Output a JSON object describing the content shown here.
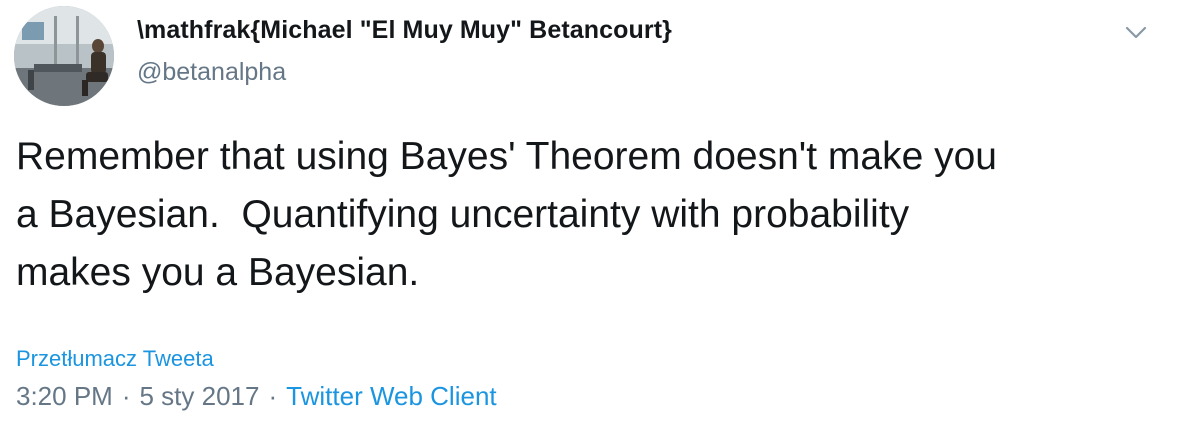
{
  "user": {
    "display_name": "\\mathfrak{Michael \"El Muy Muy\" Betancourt}",
    "handle": "@betanalpha"
  },
  "tweet": {
    "text": "Remember that using Bayes' Theorem doesn't make you\na Bayesian.  Quantifying uncertainty with probability\nmakes you a Bayesian.",
    "translate_label": "Przetłumacz Tweeta",
    "time": "3:20 PM",
    "separator": "·",
    "date": "5 sty 2017",
    "source": "Twitter Web Client"
  },
  "icons": {
    "menu": "chevron-down-icon",
    "avatar": "user-avatar"
  },
  "colors": {
    "link": "#1b95e0",
    "secondary_text": "#657786",
    "primary_text": "#14171a"
  }
}
